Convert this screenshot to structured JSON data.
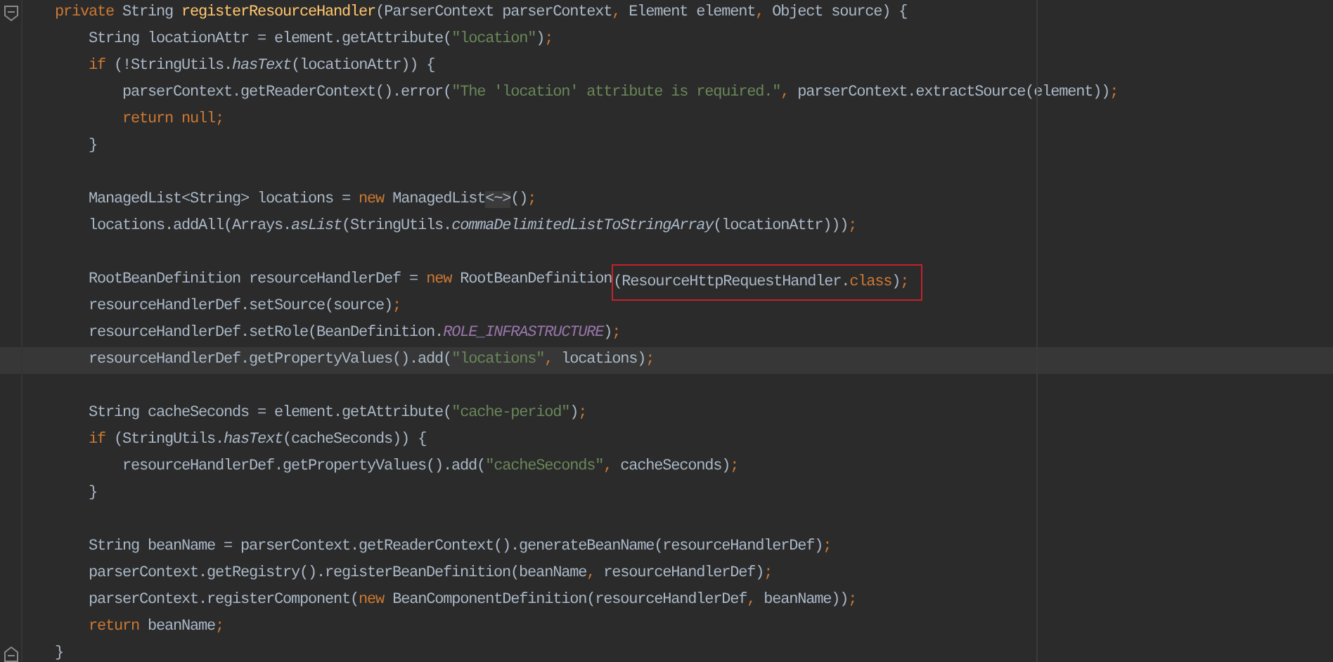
{
  "editor": {
    "lines": [
      {
        "kind": "code",
        "current": false,
        "fold": {
          "kind": "start"
        },
        "segments": [
          {
            "boxed": false,
            "tokens": [
              {
                "kind": "keyword",
                "text": "private"
              },
              {
                "kind": "plain",
                "text": " String "
              },
              {
                "kind": "method",
                "text": "registerResourceHandler"
              },
              {
                "kind": "plain",
                "text": "(ParserContext parserContext"
              },
              {
                "kind": "keyword",
                "text": ","
              },
              {
                "kind": "plain",
                "text": " Element element"
              },
              {
                "kind": "keyword",
                "text": ","
              },
              {
                "kind": "plain",
                "text": " Object source) {"
              }
            ]
          }
        ]
      },
      {
        "kind": "code",
        "current": false,
        "segments": [
          {
            "boxed": false,
            "tokens": [
              {
                "kind": "plain",
                "text": "    String locationAttr = element.getAttribute("
              },
              {
                "kind": "string",
                "text": "\"location\""
              },
              {
                "kind": "plain",
                "text": ")"
              },
              {
                "kind": "keyword",
                "text": ";"
              }
            ]
          }
        ]
      },
      {
        "kind": "code",
        "current": false,
        "segments": [
          {
            "boxed": false,
            "tokens": [
              {
                "kind": "keyword",
                "text": "    if"
              },
              {
                "kind": "plain",
                "text": " (!StringUtils."
              },
              {
                "kind": "static",
                "text": "hasText"
              },
              {
                "kind": "plain",
                "text": "(locationAttr)) {"
              }
            ]
          }
        ]
      },
      {
        "kind": "code",
        "current": false,
        "segments": [
          {
            "boxed": false,
            "tokens": [
              {
                "kind": "plain",
                "text": "        parserContext.getReaderContext().error("
              },
              {
                "kind": "string",
                "text": "\"The 'location' attribute is required.\""
              },
              {
                "kind": "keyword",
                "text": ","
              },
              {
                "kind": "plain",
                "text": " parserContext.extractSource(element))"
              },
              {
                "kind": "keyword",
                "text": ";"
              }
            ]
          }
        ]
      },
      {
        "kind": "code",
        "current": false,
        "segments": [
          {
            "boxed": false,
            "tokens": [
              {
                "kind": "keyword",
                "text": "        return null;"
              }
            ]
          }
        ]
      },
      {
        "kind": "code",
        "current": false,
        "segments": [
          {
            "boxed": false,
            "tokens": [
              {
                "kind": "plain",
                "text": "    }"
              }
            ]
          }
        ]
      },
      {
        "kind": "blank",
        "current": false
      },
      {
        "kind": "code",
        "current": false,
        "segments": [
          {
            "boxed": false,
            "tokens": [
              {
                "kind": "plain",
                "text": "    ManagedList<String> locations = "
              },
              {
                "kind": "keyword",
                "text": "new"
              },
              {
                "kind": "plain",
                "text": " ManagedList"
              },
              {
                "kind": "folded",
                "text": "<~>"
              },
              {
                "kind": "plain",
                "text": "()"
              },
              {
                "kind": "keyword",
                "text": ";"
              }
            ]
          }
        ]
      },
      {
        "kind": "code",
        "current": false,
        "segments": [
          {
            "boxed": false,
            "tokens": [
              {
                "kind": "plain",
                "text": "    locations.addAll(Arrays."
              },
              {
                "kind": "static",
                "text": "asList"
              },
              {
                "kind": "plain",
                "text": "(StringUtils."
              },
              {
                "kind": "static",
                "text": "commaDelimitedListToStringArray"
              },
              {
                "kind": "plain",
                "text": "(locationAttr)))"
              },
              {
                "kind": "keyword",
                "text": ";"
              }
            ]
          }
        ]
      },
      {
        "kind": "blank",
        "current": false
      },
      {
        "kind": "code",
        "current": false,
        "segments": [
          {
            "boxed": false,
            "tokens": [
              {
                "kind": "plain",
                "text": "    RootBeanDefinition resourceHandlerDef = "
              },
              {
                "kind": "keyword",
                "text": "new"
              },
              {
                "kind": "plain",
                "text": " RootBeanDefinition"
              }
            ]
          },
          {
            "boxed": true,
            "tokens": [
              {
                "kind": "plain",
                "text": "(ResourceHttpRequestHandler."
              },
              {
                "kind": "keyword",
                "text": "class"
              },
              {
                "kind": "plain",
                "text": ")"
              },
              {
                "kind": "keyword",
                "text": ";"
              }
            ]
          }
        ]
      },
      {
        "kind": "code",
        "current": false,
        "segments": [
          {
            "boxed": false,
            "tokens": [
              {
                "kind": "plain",
                "text": "    resourceHandlerDef.setSource(source)"
              },
              {
                "kind": "keyword",
                "text": ";"
              }
            ]
          }
        ]
      },
      {
        "kind": "code",
        "current": false,
        "segments": [
          {
            "boxed": false,
            "tokens": [
              {
                "kind": "plain",
                "text": "    resourceHandlerDef.setRole(BeanDefinition."
              },
              {
                "kind": "constant",
                "text": "ROLE_INFRASTRUCTURE"
              },
              {
                "kind": "plain",
                "text": ")"
              },
              {
                "kind": "keyword",
                "text": ";"
              }
            ]
          }
        ]
      },
      {
        "kind": "code",
        "current": true,
        "segments": [
          {
            "boxed": false,
            "tokens": [
              {
                "kind": "plain",
                "text": "    resourceHandlerDef.getPropertyValues().add("
              },
              {
                "kind": "string",
                "text": "\"locations\""
              },
              {
                "kind": "keyword",
                "text": ","
              },
              {
                "kind": "plain",
                "text": " locations)"
              },
              {
                "kind": "keyword",
                "text": ";"
              }
            ]
          }
        ]
      },
      {
        "kind": "blank",
        "current": false
      },
      {
        "kind": "code",
        "current": false,
        "segments": [
          {
            "boxed": false,
            "tokens": [
              {
                "kind": "plain",
                "text": "    String cacheSeconds = element.getAttribute("
              },
              {
                "kind": "string",
                "text": "\"cache-period\""
              },
              {
                "kind": "plain",
                "text": ")"
              },
              {
                "kind": "keyword",
                "text": ";"
              }
            ]
          }
        ]
      },
      {
        "kind": "code",
        "current": false,
        "segments": [
          {
            "boxed": false,
            "tokens": [
              {
                "kind": "keyword",
                "text": "    if"
              },
              {
                "kind": "plain",
                "text": " (StringUtils."
              },
              {
                "kind": "static",
                "text": "hasText"
              },
              {
                "kind": "plain",
                "text": "(cacheSeconds)) {"
              }
            ]
          }
        ]
      },
      {
        "kind": "code",
        "current": false,
        "segments": [
          {
            "boxed": false,
            "tokens": [
              {
                "kind": "plain",
                "text": "        resourceHandlerDef.getPropertyValues().add("
              },
              {
                "kind": "string",
                "text": "\"cacheSeconds\""
              },
              {
                "kind": "keyword",
                "text": ","
              },
              {
                "kind": "plain",
                "text": " cacheSeconds)"
              },
              {
                "kind": "keyword",
                "text": ";"
              }
            ]
          }
        ]
      },
      {
        "kind": "code",
        "current": false,
        "segments": [
          {
            "boxed": false,
            "tokens": [
              {
                "kind": "plain",
                "text": "    }"
              }
            ]
          }
        ]
      },
      {
        "kind": "blank",
        "current": false
      },
      {
        "kind": "code",
        "current": false,
        "segments": [
          {
            "boxed": false,
            "tokens": [
              {
                "kind": "plain",
                "text": "    String beanName = parserContext.getReaderContext().generateBeanName(resourceHandlerDef)"
              },
              {
                "kind": "keyword",
                "text": ";"
              }
            ]
          }
        ]
      },
      {
        "kind": "code",
        "current": false,
        "segments": [
          {
            "boxed": false,
            "tokens": [
              {
                "kind": "plain",
                "text": "    parserContext.getRegistry().registerBeanDefinition(beanName"
              },
              {
                "kind": "keyword",
                "text": ","
              },
              {
                "kind": "plain",
                "text": " resourceHandlerDef)"
              },
              {
                "kind": "keyword",
                "text": ";"
              }
            ]
          }
        ]
      },
      {
        "kind": "code",
        "current": false,
        "segments": [
          {
            "boxed": false,
            "tokens": [
              {
                "kind": "plain",
                "text": "    parserContext.registerComponent("
              },
              {
                "kind": "keyword",
                "text": "new"
              },
              {
                "kind": "plain",
                "text": " BeanComponentDefinition(resourceHandlerDef"
              },
              {
                "kind": "keyword",
                "text": ","
              },
              {
                "kind": "plain",
                "text": " beanName))"
              },
              {
                "kind": "keyword",
                "text": ";"
              }
            ]
          }
        ]
      },
      {
        "kind": "code",
        "current": false,
        "segments": [
          {
            "boxed": false,
            "tokens": [
              {
                "kind": "keyword",
                "text": "    return"
              },
              {
                "kind": "plain",
                "text": " beanName"
              },
              {
                "kind": "keyword",
                "text": ";"
              }
            ]
          }
        ]
      },
      {
        "kind": "code",
        "current": false,
        "fold": {
          "kind": "end"
        },
        "segments": [
          {
            "boxed": false,
            "tokens": [
              {
                "kind": "plain",
                "text": "}"
              }
            ]
          }
        ]
      }
    ]
  }
}
